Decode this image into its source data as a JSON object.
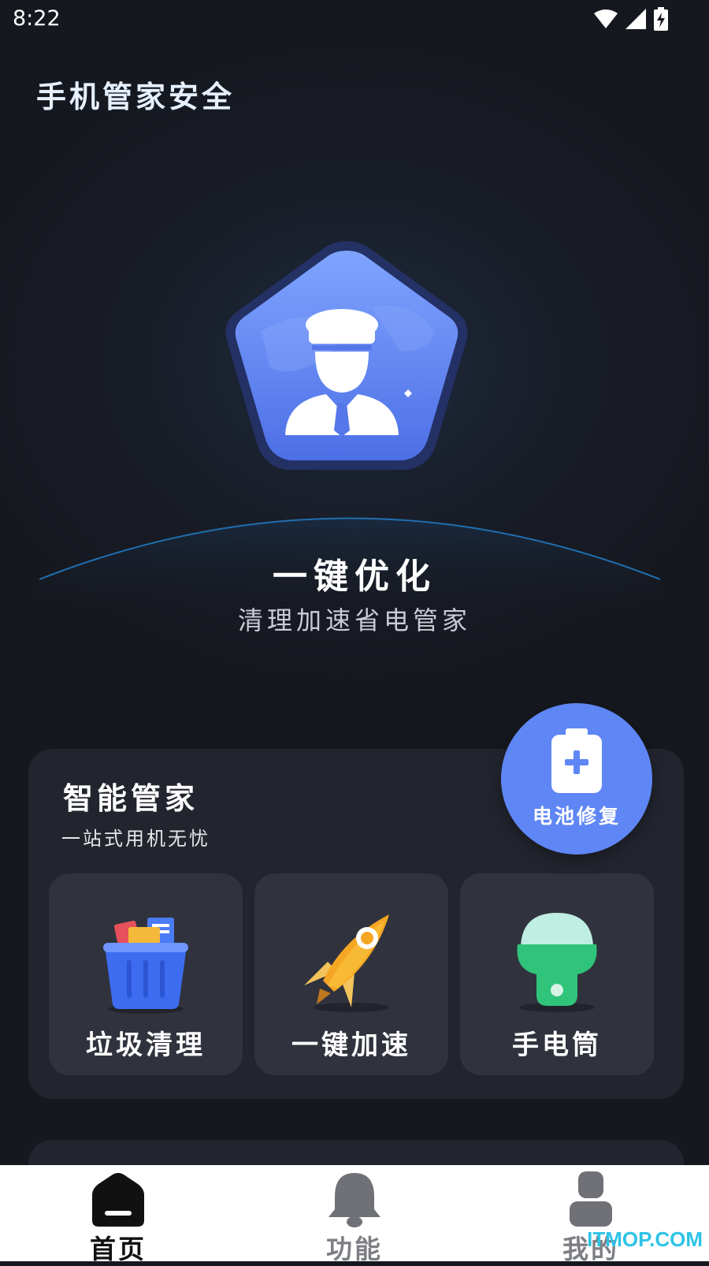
{
  "status_bar": {
    "time": "8:22",
    "icons": [
      "wifi-icon",
      "signal-icon",
      "battery-charging-icon"
    ]
  },
  "app_title": "手机管家安全",
  "hero": {
    "icon": "butler-badge-icon",
    "title": "一键优化",
    "subtitle": "清理加速省电管家"
  },
  "card": {
    "title": "智能管家",
    "subtitle": "一站式用机无忧",
    "tiles": [
      {
        "label": "垃圾清理",
        "icon": "trash-bin-icon"
      },
      {
        "label": "一键加速",
        "icon": "rocket-icon"
      },
      {
        "label": "手电筒",
        "icon": "flashlight-icon"
      }
    ]
  },
  "battery_fab": {
    "label": "电池修复",
    "icon": "battery-plus-icon"
  },
  "bottom_nav": {
    "items": [
      {
        "label": "首页",
        "icon": "home-icon",
        "active": true
      },
      {
        "label": "功能",
        "icon": "bell-icon",
        "active": false
      },
      {
        "label": "我的",
        "icon": "user-icon",
        "active": false
      }
    ]
  },
  "watermark": "ITMOP.COM",
  "colors": {
    "background": "#16181f",
    "card": "#22252e",
    "tile": "#30333d",
    "accent": "#5f86f5",
    "nav_bg": "#ffffff"
  }
}
